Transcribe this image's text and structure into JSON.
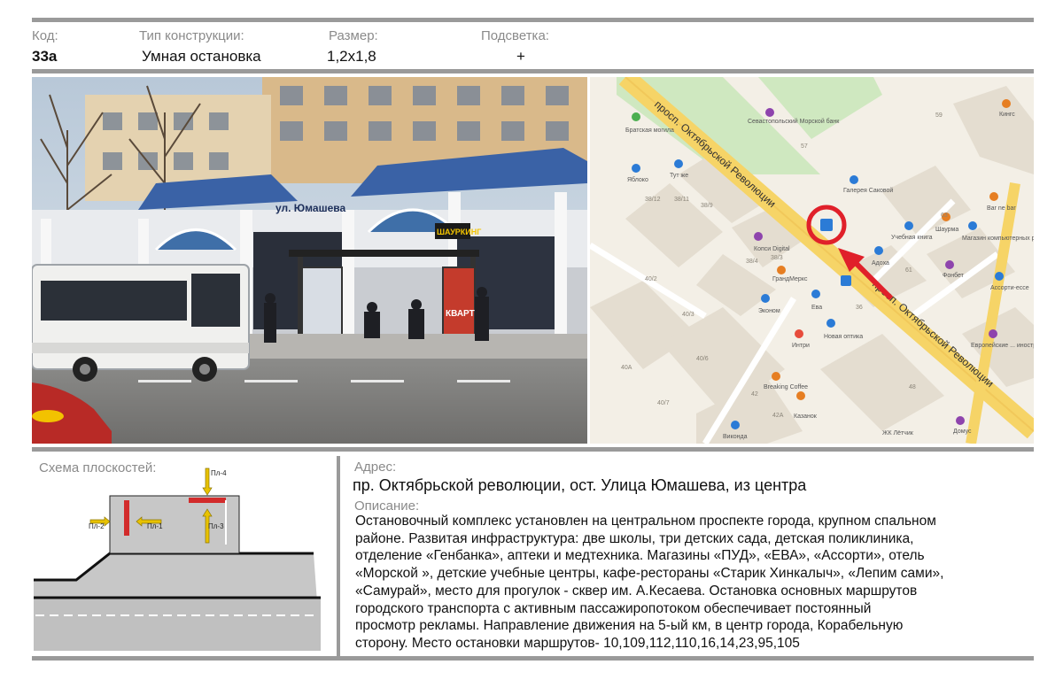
{
  "header": {
    "code_label": "Код:",
    "code_value": "33а",
    "type_label": "Тип конструкции:",
    "type_value": "Умная остановка",
    "size_label": "Размер:",
    "size_value": "1,2x1,8",
    "light_label": "Подсветка:",
    "light_value": "+"
  },
  "photo": {
    "store_sign": "ул. Юмашева",
    "bus_plate": "",
    "shop_sign": "КВАРТ",
    "kiosk_sign": "ШАУРКИНГ"
  },
  "map": {
    "street_top": "просп. Октябрьской Революции",
    "street_bottom": "просп. Октябрьской Революции",
    "pois": [
      {
        "name": "Братская могила"
      },
      {
        "name": "Севастопольский Морской банк"
      },
      {
        "name": "Яблоко"
      },
      {
        "name": "Тут же"
      },
      {
        "name": "Галерея Саковой"
      },
      {
        "name": "Копси Digital"
      },
      {
        "name": "ГрандМеркс"
      },
      {
        "name": "Эконом"
      },
      {
        "name": "Ева"
      },
      {
        "name": "Новая оптика"
      },
      {
        "name": "Интри"
      },
      {
        "name": "Breaking Coffee"
      },
      {
        "name": "Казанок"
      },
      {
        "name": "Виконда"
      },
      {
        "name": "Учебная книга"
      },
      {
        "name": "Адоха"
      },
      {
        "name": "Шаурма"
      },
      {
        "name": "Магазин компьютерных растений"
      },
      {
        "name": "Bar ne bar"
      },
      {
        "name": "Фонбет"
      },
      {
        "name": "Кингс"
      },
      {
        "name": "Ассорти-ессе"
      },
      {
        "name": "Европейские ... иностранных языков"
      },
      {
        "name": "Домус"
      },
      {
        "name": "ЖК Лётчик"
      }
    ],
    "house_numbers": [
      "59",
      "38/12",
      "38/11",
      "38/9",
      "57",
      "38/4",
      "38/3",
      "40/2",
      "40/3",
      "40/6",
      "40А",
      "40/7",
      "42",
      "36",
      "61",
      "63",
      "42А",
      "48"
    ]
  },
  "scheme": {
    "title": "Схема плоскостей:",
    "labels": [
      "Пл-1",
      "Пл-2",
      "Пл-3",
      "Пл-4"
    ]
  },
  "address": {
    "label": "Адрес:",
    "value": "пр. Октябрьской революции, ост. Улица Юмашева, из  центра"
  },
  "description": {
    "label": "Описание:",
    "lines": [
      "Остановочный комплекс установлен на центральном проспекте города, крупном спальном",
      "районе. Развитая инфраструктура: две  школы, три  детских сада, детская поликлиника,",
      "отделение  «Генбанка», аптеки и  медтехника. Магазины «ПУД», «ЕВА», «Ассорти», отель",
      "«Морской », детские учебные центры, кафе-рестораны «Старик Хинкалыч», «Лепим сами»,",
      "«Самурай», место для прогулок -  сквер им. А.Кесаева. Остановка основных маршрутов",
      "городского транспорта с активным пассажиропотоком обеспечивает постоянный",
      "просмотр рекламы. Направление движения на 5-ый  км, в центр города, Корабельную",
      "сторону.   Место остановки маршрутов- 10,109,112,110,16,14,23,95,105"
    ]
  },
  "colors": {
    "rule": "#9a9a9a",
    "plane": "#d22b2b",
    "arrow": "#e8c200",
    "map_marker": "#e0202a"
  }
}
